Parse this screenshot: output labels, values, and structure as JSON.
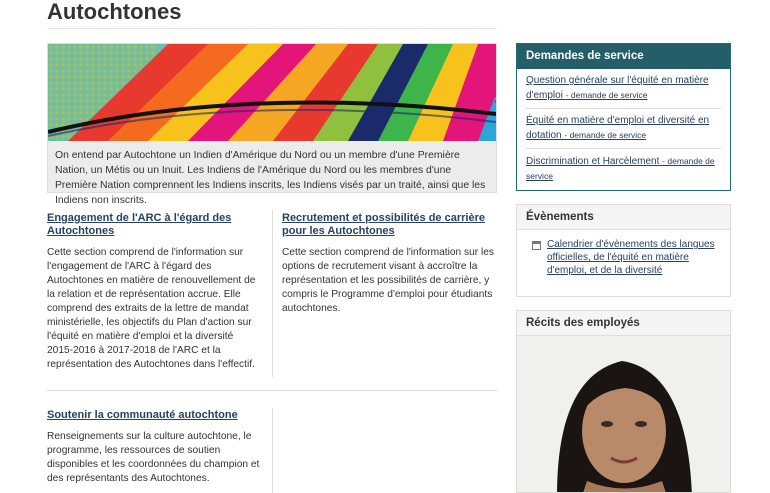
{
  "page": {
    "title": "Autochtones"
  },
  "hero": {
    "caption": "On entend par Autochtone un Indien d'Amérique du Nord ou un membre d'une Première Nation, un Métis ou un Inuit. Les Indiens de l'Amérique du Nord ou les membres d'une Première Nation comprennent les Indiens inscrits, les Indiens visés par un traité, ainsi que les Indiens non inscrits."
  },
  "sections": [
    {
      "title": "Engagement de l'ARC à l'égard des Autochtones",
      "text": "Cette section comprend de l'information sur l'engagement de l'ARC à l'égard des Autochtones en matière de renouvellement de la relation et de représentation accrue. Elle comprend des extraits de la lettre de mandat ministérielle, les objectifs du Plan d'action sur l'équité en matière d'emploi et la diversité 2015-2016 à 2017-2018 de l'ARC et la représentation des Autochtones dans l'effectif."
    },
    {
      "title": "Recrutement et possibilités de carrière pour les Autochtones",
      "text": "Cette section comprend de l'information sur les options de recrutement visant à accroître la représentation et les possibilités de carrière, y compris le Programme d'emploi pour étudiants autochtones."
    },
    {
      "title": "Soutenir la communauté autochtone",
      "text": "Renseignements sur la culture autochtone, le programme, les ressources de soutien disponibles et les coordonnées du champion et des représentants des Autochtones."
    }
  ],
  "service_requests": {
    "heading": "Demandes de service",
    "items": [
      {
        "label": "Question générale sur l'équité en matière d'emploi",
        "sub": "- demande de service"
      },
      {
        "label": "Équité en matière d'emploi et diversité en dotation",
        "sub": "- demande de service"
      },
      {
        "label": "Discrimination et Harcèlement",
        "sub": "- demande de service"
      }
    ]
  },
  "events": {
    "heading": "Évènements",
    "link": "Calendrier d'évènements des langues officielles, de l'équité en matière d'emploi, et de la diversité",
    "icon": "calendar-icon"
  },
  "stories": {
    "heading": "Récits des employés"
  },
  "colors": {
    "accent": "#245f69",
    "link": "#284162"
  }
}
